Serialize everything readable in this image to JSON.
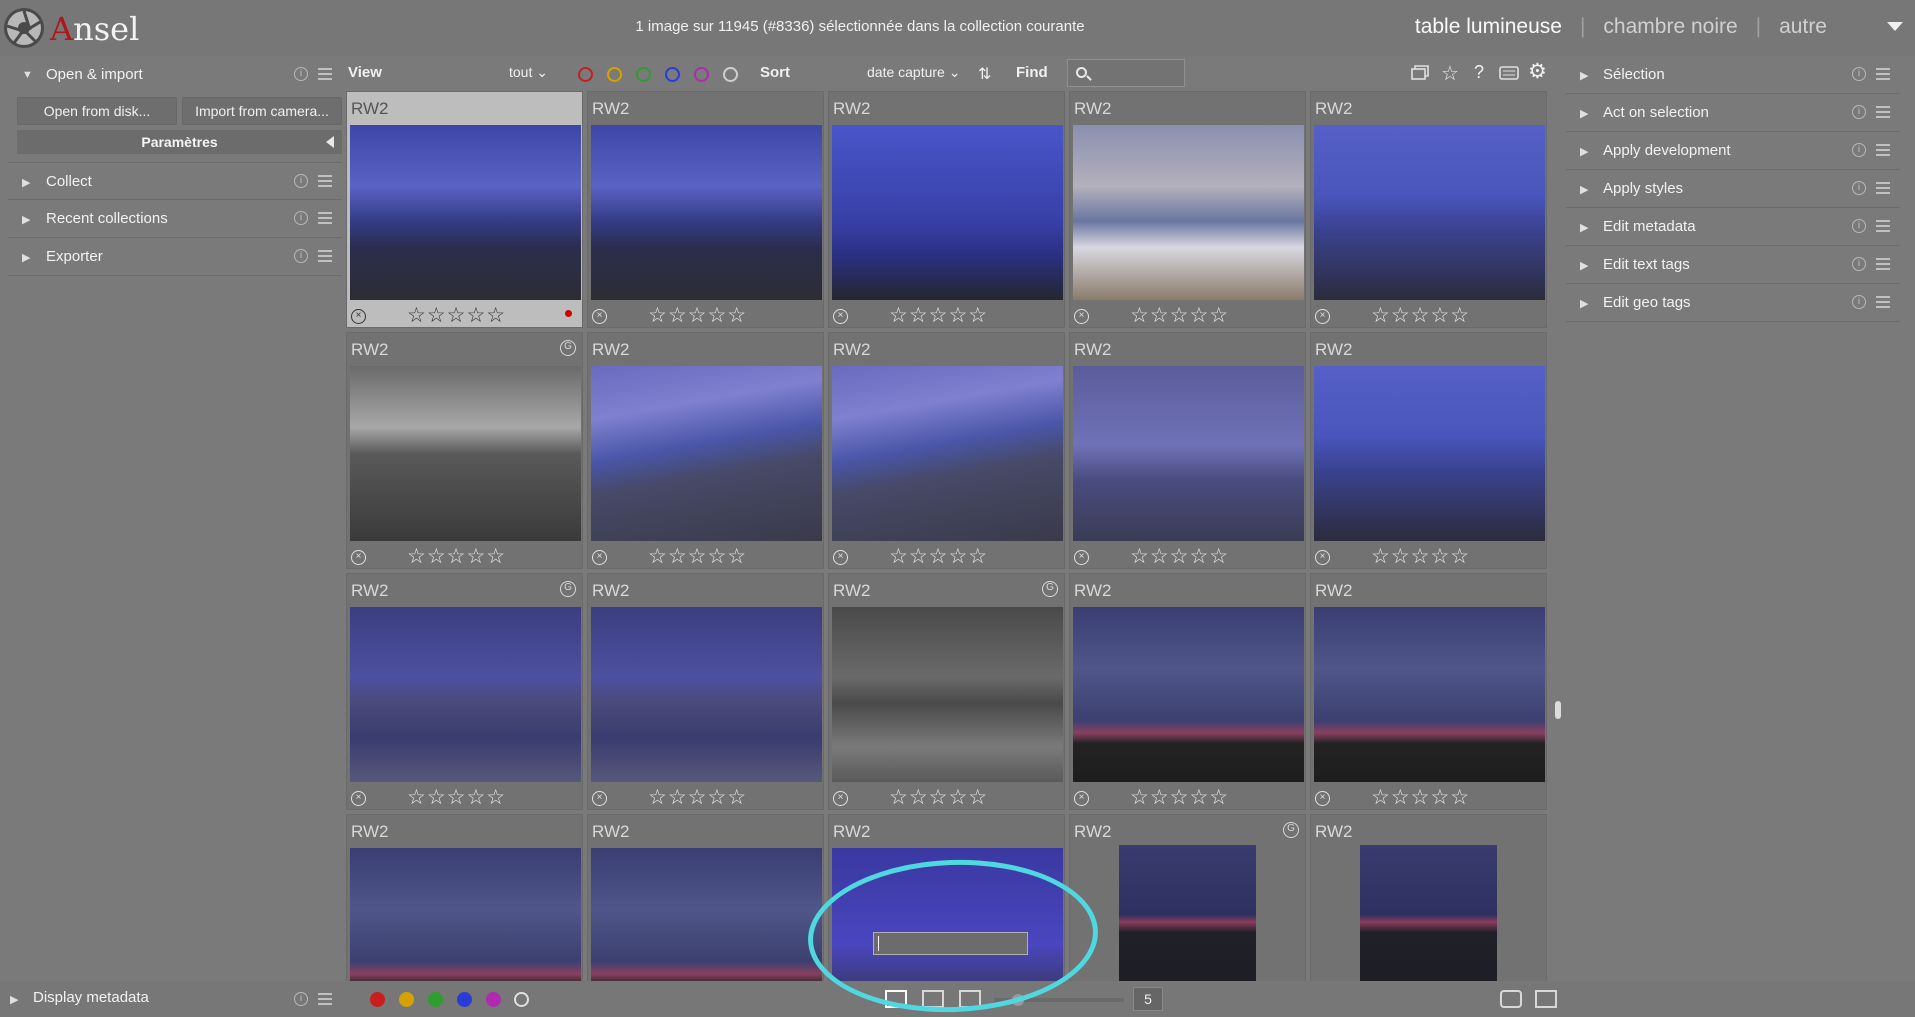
{
  "app": {
    "name": "Ansel",
    "logo_initial": "A",
    "logo_rest": "nsel"
  },
  "header": {
    "title": "1 image sur 11945 (#8336) sélectionnée dans la collection courante",
    "views": [
      "table lumineuse",
      "chambre noire",
      "autre"
    ],
    "view_sep": "|"
  },
  "left_panel": {
    "open_import": {
      "label": "Open & import",
      "expanded": true
    },
    "open_from_disk": "Open from disk...",
    "import_from_camera": "Import from camera...",
    "parametres": "Paramètres",
    "modules": [
      {
        "label": "Collect"
      },
      {
        "label": "Recent collections"
      },
      {
        "label": "Exporter"
      }
    ],
    "display_metadata": "Display metadata"
  },
  "toolbar": {
    "view_label": "View",
    "view_filter": "tout",
    "color_labels": [
      "#c81e1e",
      "#d6a200",
      "#2e9e2e",
      "#2a3cd8",
      "#b02ab0",
      "#cfcfcf"
    ],
    "sort_label": "Sort",
    "sort_value": "date capture",
    "find_label": "Find",
    "search_placeholder": ""
  },
  "grid": {
    "columns": 5,
    "thumbnails": [
      {
        "format": "RW2",
        "selected": true,
        "rating": 0,
        "red_label": true,
        "grouped": false,
        "scene": "rocks-blue"
      },
      {
        "format": "RW2",
        "selected": false,
        "rating": 0,
        "red_label": false,
        "grouped": false,
        "scene": "rocks-blue"
      },
      {
        "format": "RW2",
        "selected": false,
        "rating": 0,
        "red_label": false,
        "grouped": false,
        "scene": "sky-blue"
      },
      {
        "format": "RW2",
        "selected": false,
        "rating": 0,
        "red_label": false,
        "grouped": false,
        "scene": "waves-day"
      },
      {
        "format": "RW2",
        "selected": false,
        "rating": 0,
        "red_label": false,
        "grouped": false,
        "scene": "beach-blue"
      },
      {
        "format": "RW2",
        "selected": false,
        "rating": 0,
        "red_label": false,
        "grouped": true,
        "scene": "beach-bw"
      },
      {
        "format": "RW2",
        "selected": false,
        "rating": 0,
        "red_label": false,
        "grouped": false,
        "scene": "beach-dusk"
      },
      {
        "format": "RW2",
        "selected": false,
        "rating": 0,
        "red_label": false,
        "grouped": false,
        "scene": "beach-dusk"
      },
      {
        "format": "RW2",
        "selected": false,
        "rating": 0,
        "red_label": false,
        "grouped": false,
        "scene": "sea-dusk"
      },
      {
        "format": "RW2",
        "selected": false,
        "rating": 0,
        "red_label": false,
        "grouped": false,
        "scene": "beach-blue"
      },
      {
        "format": "RW2",
        "selected": false,
        "rating": 0,
        "red_label": false,
        "grouped": true,
        "scene": "town-night"
      },
      {
        "format": "RW2",
        "selected": false,
        "rating": 0,
        "red_label": false,
        "grouped": false,
        "scene": "town-night"
      },
      {
        "format": "RW2",
        "selected": false,
        "rating": 0,
        "red_label": false,
        "grouped": true,
        "scene": "town-bw"
      },
      {
        "format": "RW2",
        "selected": false,
        "rating": 0,
        "red_label": false,
        "grouped": false,
        "scene": "horizon-dark"
      },
      {
        "format": "RW2",
        "selected": false,
        "rating": 0,
        "red_label": false,
        "grouped": false,
        "scene": "horizon-dark"
      },
      {
        "format": "RW2",
        "selected": false,
        "rating": 0,
        "red_label": false,
        "grouped": false,
        "scene": "horizon-dark"
      },
      {
        "format": "RW2",
        "selected": false,
        "rating": 0,
        "red_label": false,
        "grouped": false,
        "scene": "horizon-dark"
      },
      {
        "format": "RW2",
        "selected": false,
        "rating": 0,
        "red_label": false,
        "grouped": false,
        "scene": "night-lights"
      },
      {
        "format": "RW2",
        "selected": false,
        "rating": 0,
        "red_label": false,
        "grouped": true,
        "scene": "portrait-dark"
      },
      {
        "format": "RW2",
        "selected": false,
        "rating": 0,
        "red_label": false,
        "grouped": false,
        "scene": "portrait-dark"
      }
    ],
    "stars_text": "☆☆☆☆☆",
    "reject_text": "×",
    "group_text": "G"
  },
  "right_panel": {
    "modules": [
      {
        "label": "Sélection"
      },
      {
        "label": "Act on selection"
      },
      {
        "label": "Apply development"
      },
      {
        "label": "Apply styles"
      },
      {
        "label": "Edit metadata"
      },
      {
        "label": "Edit text tags"
      },
      {
        "label": "Edit geo tags"
      }
    ]
  },
  "bottom": {
    "color_labels": [
      "#c81e1e",
      "#d6a200",
      "#2e9e2e",
      "#2a3cd8",
      "#b02ab0"
    ],
    "zoom_columns": "5",
    "popup_input_value": ""
  },
  "colors": {
    "annotation": "#4fd8e0",
    "red_label": "#d00000"
  }
}
